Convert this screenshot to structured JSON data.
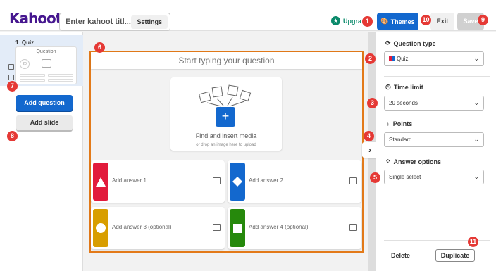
{
  "header": {
    "logo": "Kahoot!",
    "title_placeholder": "Enter kahoot titl...",
    "settings_label": "Settings",
    "upgrade_label": "Upgra",
    "themes_label": "Themes",
    "exit_label": "Exit",
    "save_label": "Save"
  },
  "sidebar": {
    "slide_number": "1",
    "slide_type": "Quiz",
    "thumb_question": "Question",
    "thumb_timer": "20",
    "add_question_label": "Add question",
    "add_slide_label": "Add slide"
  },
  "editor": {
    "question_placeholder": "Start typing your question",
    "media_title": "Find and insert media",
    "media_hint": "or drop an image here to upload",
    "answers": [
      {
        "label": "Add answer 1",
        "color": "#e21b3c",
        "shape": "triangle"
      },
      {
        "label": "Add answer 2",
        "color": "#1368ce",
        "shape": "diamond"
      },
      {
        "label": "Add answer 3 (optional)",
        "color": "#d89e00",
        "shape": "circle"
      },
      {
        "label": "Add answer 4 (optional)",
        "color": "#26890c",
        "shape": "square"
      }
    ]
  },
  "settings_panel": {
    "question_type_label": "Question type",
    "question_type_value": "Quiz",
    "time_limit_label": "Time limit",
    "time_limit_value": "20 seconds",
    "points_label": "Points",
    "points_value": "Standard",
    "answer_options_label": "Answer options",
    "answer_options_value": "Single select",
    "delete_label": "Delete",
    "duplicate_label": "Duplicate"
  },
  "markers": [
    "1",
    "2",
    "3",
    "4",
    "5",
    "6",
    "7",
    "8",
    "9",
    "10",
    "11"
  ],
  "colors": {
    "brand": "#46178f",
    "primary_blue": "#1368ce",
    "upgrade_green": "#0b8a6b",
    "highlight_orange": "#e37a19",
    "marker_red": "#e53935"
  }
}
